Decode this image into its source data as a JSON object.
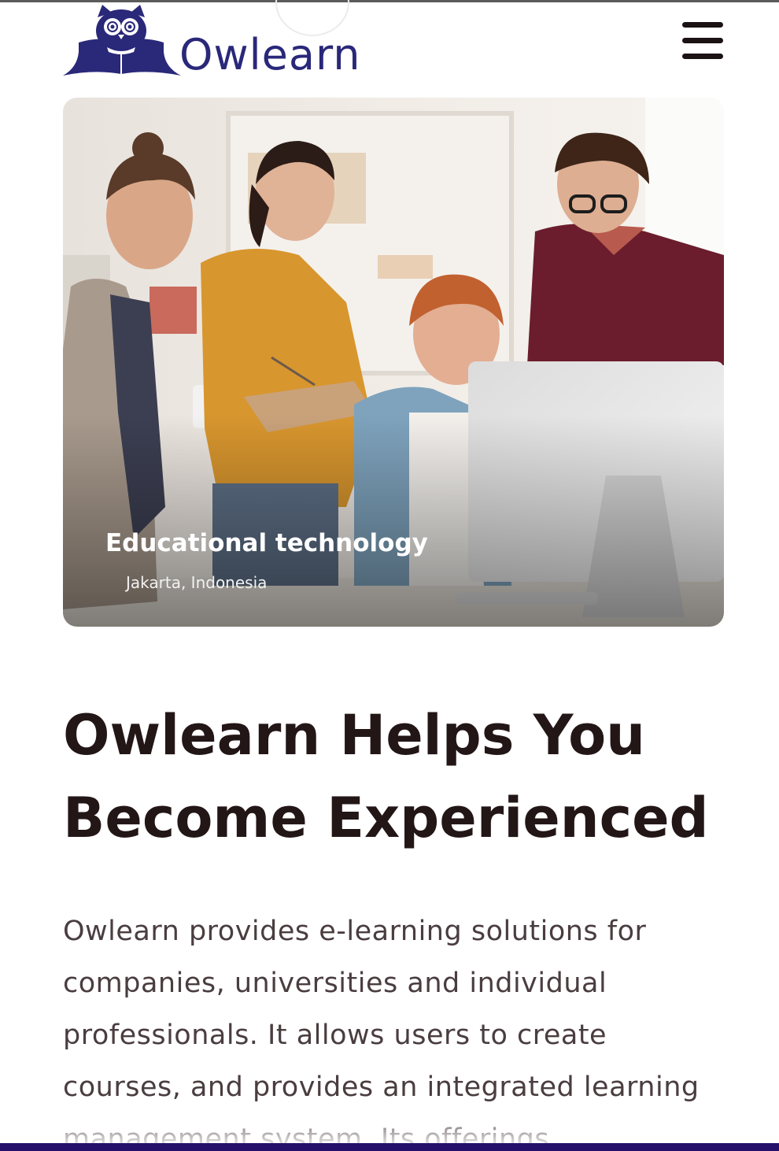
{
  "brand": {
    "name": "Owlearn",
    "logo_icon": "owl-on-book-icon",
    "color": "#2a2879"
  },
  "header": {
    "menu_icon": "hamburger-menu-icon"
  },
  "hero": {
    "title": "Educational technology",
    "location": "Jakarta, Indonesia"
  },
  "main": {
    "headline": "Owlearn Helps You Become Experienced",
    "body": "Owlearn provides e-learning solutions for companies, universities and individual professionals. It allows users to create courses, and provides an integrated learning management system. Its offerings"
  },
  "colors": {
    "text_dark": "#231617",
    "text_body": "#4a3d40",
    "accent_bottom": "#25106b"
  }
}
